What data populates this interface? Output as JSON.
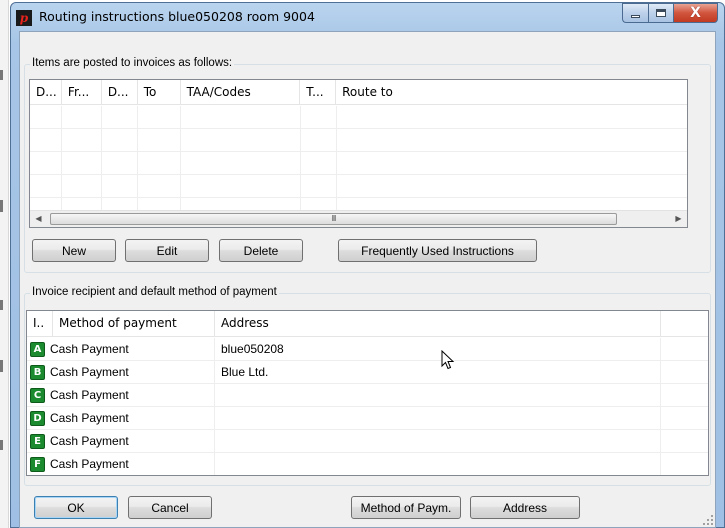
{
  "window": {
    "title": "Routing instructions blue050208  room 9004",
    "app_icon_letter": "p",
    "close_glyph": "X"
  },
  "routing": {
    "group_title": "Items are posted to invoices as follows:",
    "columns": [
      "D...",
      "Fr...",
      "D...",
      "To",
      "TAA/Codes",
      "T...",
      "Route to"
    ],
    "rows": [],
    "scrollbar_grip": "III"
  },
  "routing_buttons": {
    "new": "New",
    "edit": "Edit",
    "delete": "Delete",
    "frequently_used": "Frequently Used  Instructions"
  },
  "recipients": {
    "group_title": "Invoice recipient and default method of payment",
    "columns": [
      "I..",
      "Method of payment",
      "Address"
    ],
    "rows": [
      {
        "letter": "A",
        "method": "Cash Payment",
        "address": "blue050208"
      },
      {
        "letter": "B",
        "method": "Cash Payment",
        "address": "Blue Ltd."
      },
      {
        "letter": "C",
        "method": "Cash Payment",
        "address": ""
      },
      {
        "letter": "D",
        "method": "Cash Payment",
        "address": ""
      },
      {
        "letter": "E",
        "method": "Cash Payment",
        "address": ""
      },
      {
        "letter": "F",
        "method": "Cash Payment",
        "address": ""
      }
    ]
  },
  "footer_buttons": {
    "ok": "OK",
    "cancel": "Cancel",
    "method_of_payment": "Method of Paym.",
    "address": "Address"
  },
  "colors": {
    "letter_badge": "#1c8a2e",
    "close_button": "#c13a21",
    "title_bar": "#a7c5e6"
  }
}
